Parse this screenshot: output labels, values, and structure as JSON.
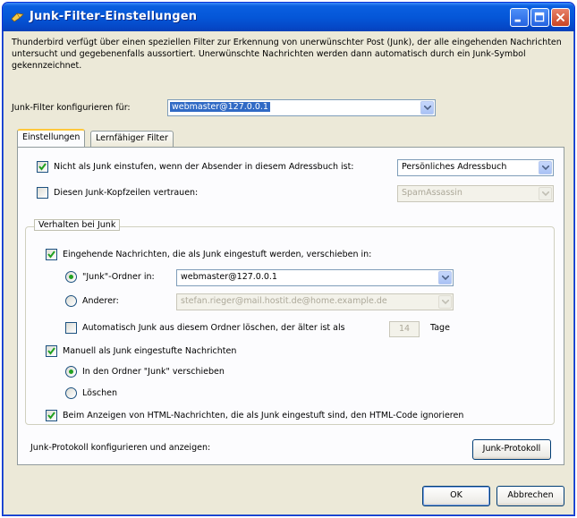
{
  "window": {
    "title": "Junk-Filter-Einstellungen",
    "controls": {
      "minimize": "minimize-icon",
      "maximize": "maximize-icon",
      "close": "close-icon"
    }
  },
  "description": "Thunderbird verfügt über einen speziellen Filter zur Erkennung von unerwünschter Post (Junk), der alle eingehenden Nachrichten untersucht und gegebenenfalls aussortiert. Unerwünschte Nachrichten werden dann automatisch durch ein Junk-Symbol gekennzeichnet.",
  "account": {
    "label": "Junk-Filter konfigurieren für:",
    "value": "webmaster@127.0.0.1"
  },
  "tabs": [
    {
      "label": "Einstellungen",
      "active": true
    },
    {
      "label": "Lernfähiger Filter",
      "active": false
    }
  ],
  "settings": {
    "whitelist": {
      "label": "Nicht als Junk einstufen, wenn der Absender in diesem Adressbuch ist:",
      "checked": true,
      "addressbook": "Persönliches Adressbuch"
    },
    "trust_headers": {
      "label": "Diesen Junk-Kopfzeilen vertrauen:",
      "checked": false,
      "value": "SpamAssassin"
    }
  },
  "behavior": {
    "title": "Verhalten bei Junk",
    "move_incoming": {
      "label": "Eingehende Nachrichten, die als Junk eingestuft werden, verschieben in:",
      "checked": true
    },
    "junk_folder": {
      "label": "\"Junk\"-Ordner in:",
      "selected": true,
      "value": "webmaster@127.0.0.1"
    },
    "other_folder": {
      "label": "Anderer:",
      "selected": false,
      "value": "stefan.rieger@mail.hostit.de@home.example.de"
    },
    "auto_delete": {
      "label": "Automatisch Junk aus diesem Ordner löschen, der älter ist als",
      "checked": false,
      "days": "14",
      "unit": "Tage"
    },
    "manual": {
      "label": "Manuell als Junk eingestufte Nachrichten",
      "checked": true
    },
    "move_to_junk": {
      "label": "In den Ordner \"Junk\" verschieben",
      "selected": true
    },
    "delete": {
      "label": "Löschen",
      "selected": false
    },
    "ignore_html": {
      "label": "Beim Anzeigen von HTML-Nachrichten, die als Junk eingestuft sind, den HTML-Code ignorieren",
      "checked": true
    }
  },
  "log": {
    "label": "Junk-Protokoll konfigurieren und anzeigen:",
    "button": "Junk-Protokoll"
  },
  "footer": {
    "ok": "OK",
    "cancel": "Abbrechen"
  },
  "colors": {
    "titlebar": "#0557d8",
    "dialog_bg": "#ece9d8",
    "selection": "#316ac5",
    "check": "#21a121"
  }
}
